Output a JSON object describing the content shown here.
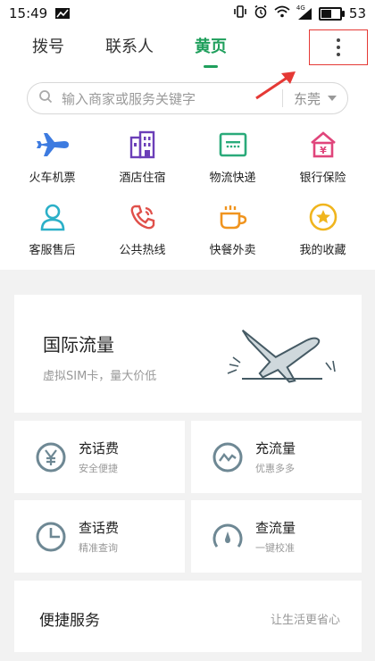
{
  "status_bar": {
    "time": "15:49",
    "battery": "53",
    "signal_label": "4G"
  },
  "tabs": [
    {
      "label": "拨号"
    },
    {
      "label": "联系人"
    },
    {
      "label": "黄页"
    }
  ],
  "accent_color": "#1f9f5c",
  "search": {
    "placeholder": "输入商家或服务关键字",
    "city": "东莞"
  },
  "categories": [
    {
      "label": "火车机票",
      "icon": "plane-icon",
      "color": "#3d7be0"
    },
    {
      "label": "酒店住宿",
      "icon": "building-icon",
      "color": "#6b3fb8"
    },
    {
      "label": "物流快递",
      "icon": "parcel-icon",
      "color": "#2aaa7a"
    },
    {
      "label": "银行保险",
      "icon": "bank-icon",
      "color": "#e0457b"
    },
    {
      "label": "客服售后",
      "icon": "person-icon",
      "color": "#2bb0c8"
    },
    {
      "label": "公共热线",
      "icon": "phone-icon",
      "color": "#e0504a"
    },
    {
      "label": "快餐外卖",
      "icon": "cup-icon",
      "color": "#f0941e"
    },
    {
      "label": "我的收藏",
      "icon": "star-icon",
      "color": "#f0b51e"
    }
  ],
  "promo": {
    "title": "国际流量",
    "subtitle": "虚拟SIM卡，量大价低"
  },
  "services": [
    {
      "title": "充话费",
      "subtitle": "安全便捷",
      "icon": "yen-icon"
    },
    {
      "title": "充流量",
      "subtitle": "优惠多多",
      "icon": "wave-icon"
    },
    {
      "title": "查话费",
      "subtitle": "精准查询",
      "icon": "pie-icon"
    },
    {
      "title": "查流量",
      "subtitle": "一键校准",
      "icon": "gauge-icon"
    }
  ],
  "quick": {
    "title": "便捷服务",
    "subtitle": "让生活更省心"
  }
}
